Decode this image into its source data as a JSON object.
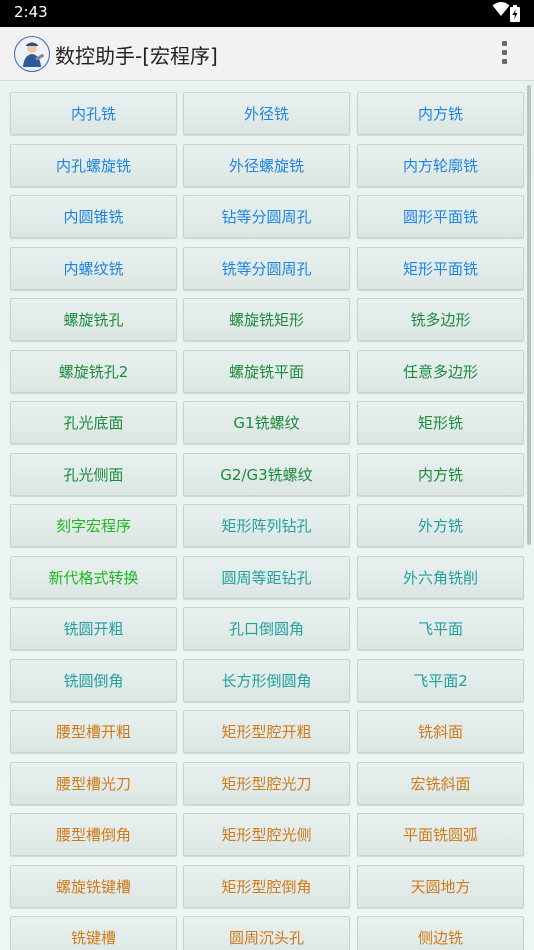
{
  "status_bar": {
    "time": "2:43",
    "icons": [
      "wifi-icon",
      "battery-icon"
    ]
  },
  "app_bar": {
    "title": "数控助手-[宏程序]",
    "menu_icon": "overflow-menu-icon"
  },
  "colors": {
    "blue": "#1f84e0",
    "green": "#1c8a3c",
    "teal": "#20a0a0",
    "bright_green": "#1fb61f",
    "orange": "#d07a1a"
  },
  "grid": {
    "rows": [
      [
        {
          "label": "内孔铣",
          "color": "#1f84e0"
        },
        {
          "label": "外径铣",
          "color": "#1f84e0"
        },
        {
          "label": "内方铣",
          "color": "#1f84e0"
        }
      ],
      [
        {
          "label": "内孔螺旋铣",
          "color": "#1f84e0"
        },
        {
          "label": "外径螺旋铣",
          "color": "#1f84e0"
        },
        {
          "label": "内方轮廓铣",
          "color": "#1f84e0"
        }
      ],
      [
        {
          "label": "内圆锥铣",
          "color": "#1f84e0"
        },
        {
          "label": "钻等分圆周孔",
          "color": "#1f84e0"
        },
        {
          "label": "圆形平面铣",
          "color": "#1f84e0"
        }
      ],
      [
        {
          "label": "内螺纹铣",
          "color": "#1f84e0"
        },
        {
          "label": "铣等分圆周孔",
          "color": "#1f84e0"
        },
        {
          "label": "矩形平面铣",
          "color": "#1f84e0"
        }
      ],
      [
        {
          "label": "螺旋铣孔",
          "color": "#1c8a3c"
        },
        {
          "label": "螺旋铣矩形",
          "color": "#1c8a3c"
        },
        {
          "label": "铣多边形",
          "color": "#1c8a3c"
        }
      ],
      [
        {
          "label": "螺旋铣孔2",
          "color": "#1c8a3c"
        },
        {
          "label": "螺旋铣平面",
          "color": "#1c8a3c"
        },
        {
          "label": "任意多边形",
          "color": "#1c8a3c"
        }
      ],
      [
        {
          "label": "孔光底面",
          "color": "#1c8a3c"
        },
        {
          "label": "G1铣螺纹",
          "color": "#1c8a3c"
        },
        {
          "label": "矩形铣",
          "color": "#1c8a3c"
        }
      ],
      [
        {
          "label": "孔光侧面",
          "color": "#1c8a3c"
        },
        {
          "label": "G2/G3铣螺纹",
          "color": "#1c8a3c"
        },
        {
          "label": "内方铣",
          "color": "#1c8a3c"
        }
      ],
      [
        {
          "label": "刻字宏程序",
          "color": "#1fb61f"
        },
        {
          "label": "矩形阵列钻孔",
          "color": "#20a0a0"
        },
        {
          "label": "外方铣",
          "color": "#20a0a0"
        }
      ],
      [
        {
          "label": "新代格式转换",
          "color": "#1fb61f"
        },
        {
          "label": "圆周等距钻孔",
          "color": "#20a0a0"
        },
        {
          "label": "外六角铣削",
          "color": "#20a0a0"
        }
      ],
      [
        {
          "label": "铣圆开粗",
          "color": "#20a0a0"
        },
        {
          "label": "孔口倒圆角",
          "color": "#20a0a0"
        },
        {
          "label": "飞平面",
          "color": "#20a0a0"
        }
      ],
      [
        {
          "label": "铣圆倒角",
          "color": "#20a0a0"
        },
        {
          "label": "长方形倒圆角",
          "color": "#20a0a0"
        },
        {
          "label": "飞平面2",
          "color": "#20a0a0"
        }
      ],
      [
        {
          "label": "腰型槽开粗",
          "color": "#d07a1a"
        },
        {
          "label": "矩形型腔开粗",
          "color": "#d07a1a"
        },
        {
          "label": "铣斜面",
          "color": "#d07a1a"
        }
      ],
      [
        {
          "label": "腰型槽光刀",
          "color": "#d07a1a"
        },
        {
          "label": "矩形型腔光刀",
          "color": "#d07a1a"
        },
        {
          "label": "宏铣斜面",
          "color": "#d07a1a"
        }
      ],
      [
        {
          "label": "腰型槽倒角",
          "color": "#d07a1a"
        },
        {
          "label": "矩形型腔光侧",
          "color": "#d07a1a"
        },
        {
          "label": "平面铣圆弧",
          "color": "#d07a1a"
        }
      ],
      [
        {
          "label": "螺旋铣键槽",
          "color": "#d07a1a"
        },
        {
          "label": "矩形型腔倒角",
          "color": "#d07a1a"
        },
        {
          "label": "天圆地方",
          "color": "#d07a1a"
        }
      ],
      [
        {
          "label": "铣键槽",
          "color": "#d07a1a"
        },
        {
          "label": "圆周沉头孔",
          "color": "#d07a1a"
        },
        {
          "label": "侧边铣",
          "color": "#d07a1a"
        }
      ]
    ]
  }
}
